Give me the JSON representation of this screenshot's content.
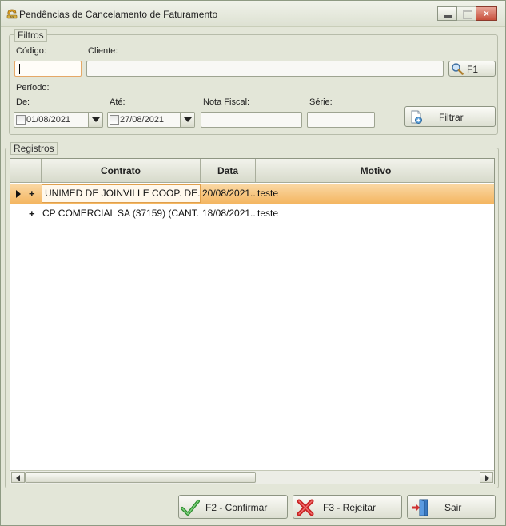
{
  "window": {
    "title": "Pendências de Cancelamento de Faturamento",
    "close_glyph": "×"
  },
  "filters": {
    "legend": "Filtros",
    "codigo_label": "Código:",
    "codigo_value": "",
    "cliente_label": "Cliente:",
    "cliente_value": "",
    "f1_label": "F1",
    "periodo_label": "Período:",
    "de_label": "De:",
    "de_value": "01/08/2021",
    "ate_label": "Até:",
    "ate_value": "27/08/2021",
    "nota_label": "Nota Fiscal:",
    "nota_value": "",
    "serie_label": "Série:",
    "serie_value": "",
    "filtrar_label": "Filtrar"
  },
  "registros": {
    "legend": "Registros",
    "columns": [
      "Contrato",
      "Data",
      "Motivo"
    ],
    "rows": [
      {
        "expand": "+",
        "contrato": "UNIMED DE JOINVILLE COOP. DE...",
        "data": "20/08/2021...",
        "motivo": "teste",
        "selected": true
      },
      {
        "expand": "+",
        "contrato": "CP COMERCIAL SA (37159) (CANT...",
        "data": "18/08/2021...",
        "motivo": "teste",
        "selected": false
      }
    ]
  },
  "actions": {
    "confirmar": "F2 - Confirmar",
    "rejeitar": "F3 - Rejeitar",
    "sair": "Sair"
  },
  "icons": [
    "app-icon",
    "magnifier-icon",
    "filter-icon",
    "check-icon",
    "x-icon",
    "exit-door-icon"
  ],
  "colors": {
    "selection": "#f4b661",
    "focus_border": "#e5a867",
    "reject_red": "#d42a2a",
    "confirm_green": "#3aa53a"
  }
}
